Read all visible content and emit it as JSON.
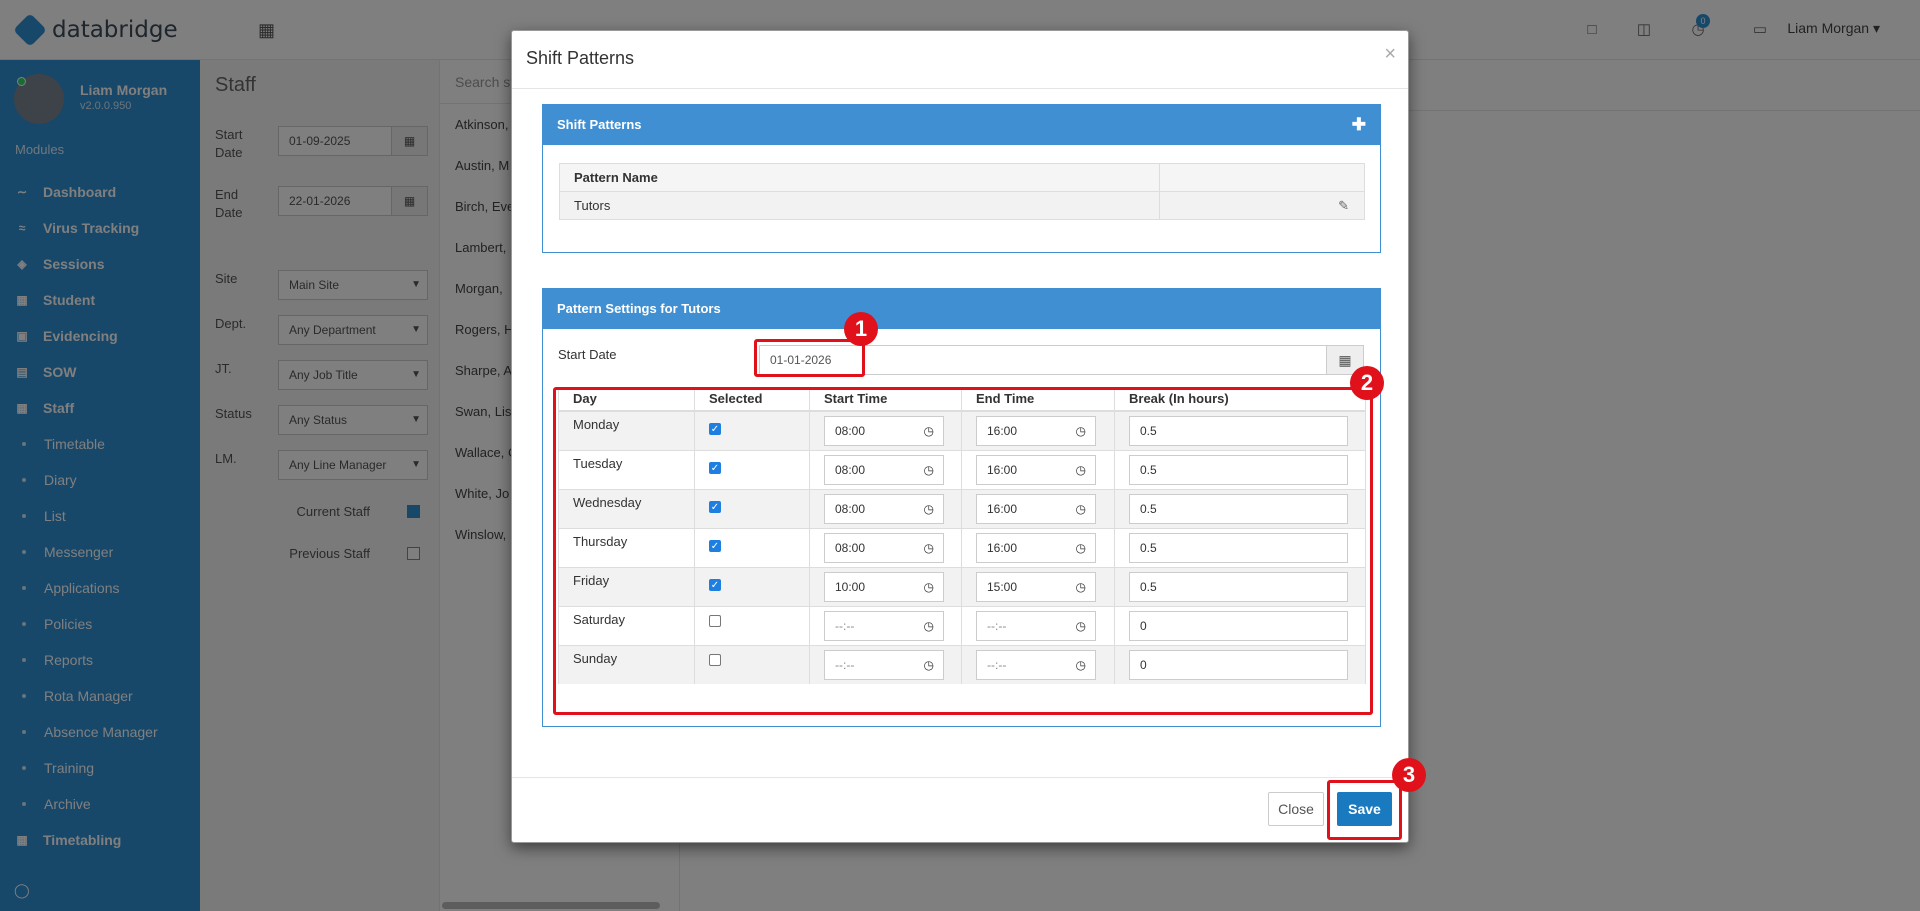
{
  "app": {
    "brand": "databridge",
    "grid_icon": "grid-icon",
    "top_icons": [
      "monitor-icon",
      "book-icon",
      "stopwatch-icon",
      "chat-icon"
    ],
    "badge_count": "0",
    "user_menu": "Liam Morgan"
  },
  "sidebar": {
    "user_name": "Liam Morgan",
    "version": "v2.0.0.950",
    "modules_label": "Modules",
    "items": [
      {
        "label": "Dashboard",
        "icon": "chart-line-icon"
      },
      {
        "label": "Virus Tracking",
        "icon": "heartbeat-icon"
      },
      {
        "label": "Sessions",
        "icon": "layers-icon"
      },
      {
        "label": "Student",
        "icon": "building-icon"
      },
      {
        "label": "Evidencing",
        "icon": "camera-icon"
      },
      {
        "label": "SOW",
        "icon": "book-icon"
      },
      {
        "label": "Staff",
        "icon": "building-icon"
      }
    ],
    "sub_items": [
      "Timetable",
      "Diary",
      "List",
      "Messenger",
      "Applications",
      "Policies",
      "Reports",
      "Rota Manager",
      "Absence Manager",
      "Training",
      "Archive"
    ],
    "bottom_item": {
      "label": "Timetabling",
      "icon": "table-icon"
    }
  },
  "staff_panel": {
    "title": "Staff",
    "start_date_label": "Start Date",
    "start_date": "01-09-2025",
    "end_date_label": "End Date",
    "end_date": "22-01-2026",
    "site_label": "Site",
    "site": "Main Site",
    "dept_label": "Dept.",
    "dept": "Any Department",
    "jt_label": "JT.",
    "jt": "Any Job Title",
    "status_label": "Status",
    "status": "Any Status",
    "lm_label": "LM.",
    "lm": "Any Line Manager",
    "current_staff_label": "Current Staff",
    "current_staff_checked": true,
    "previous_staff_label": "Previous Staff",
    "previous_staff_checked": false
  },
  "staff_list": {
    "search_placeholder": "Search sta",
    "rows": [
      "Atkinson,",
      "Austin, M",
      "Birch, Eve",
      "Lambert,",
      "Morgan,",
      "Rogers, H",
      "Sharpe, A",
      "Swan, Lis",
      "Wallace, C",
      "White, Jo",
      "Winslow,"
    ]
  },
  "modal": {
    "title": "Shift Patterns",
    "close_symbol": "×",
    "patterns_panel": {
      "heading": "Shift Patterns",
      "column_header": "Pattern Name",
      "rows": [
        "Tutors"
      ]
    },
    "settings_panel": {
      "heading": "Pattern Settings for Tutors",
      "start_date_label": "Start Date",
      "start_date": "01-01-2026",
      "columns": [
        "Day",
        "Selected",
        "Start Time",
        "End Time",
        "Break (In hours)"
      ],
      "days": [
        {
          "day": "Monday",
          "selected": true,
          "start": "08:00",
          "end": "16:00",
          "break": "0.5"
        },
        {
          "day": "Tuesday",
          "selected": true,
          "start": "08:00",
          "end": "16:00",
          "break": "0.5"
        },
        {
          "day": "Wednesday",
          "selected": true,
          "start": "08:00",
          "end": "16:00",
          "break": "0.5"
        },
        {
          "day": "Thursday",
          "selected": true,
          "start": "08:00",
          "end": "16:00",
          "break": "0.5"
        },
        {
          "day": "Friday",
          "selected": true,
          "start": "10:00",
          "end": "15:00",
          "break": "0.5"
        },
        {
          "day": "Saturday",
          "selected": false,
          "start": "--:--",
          "end": "--:--",
          "break": "0"
        },
        {
          "day": "Sunday",
          "selected": false,
          "start": "--:--",
          "end": "--:--",
          "break": "0"
        }
      ]
    },
    "close_button": "Close",
    "save_button": "Save"
  },
  "annotations": {
    "color": "#e0111b",
    "markers": [
      "1",
      "2",
      "3"
    ]
  }
}
